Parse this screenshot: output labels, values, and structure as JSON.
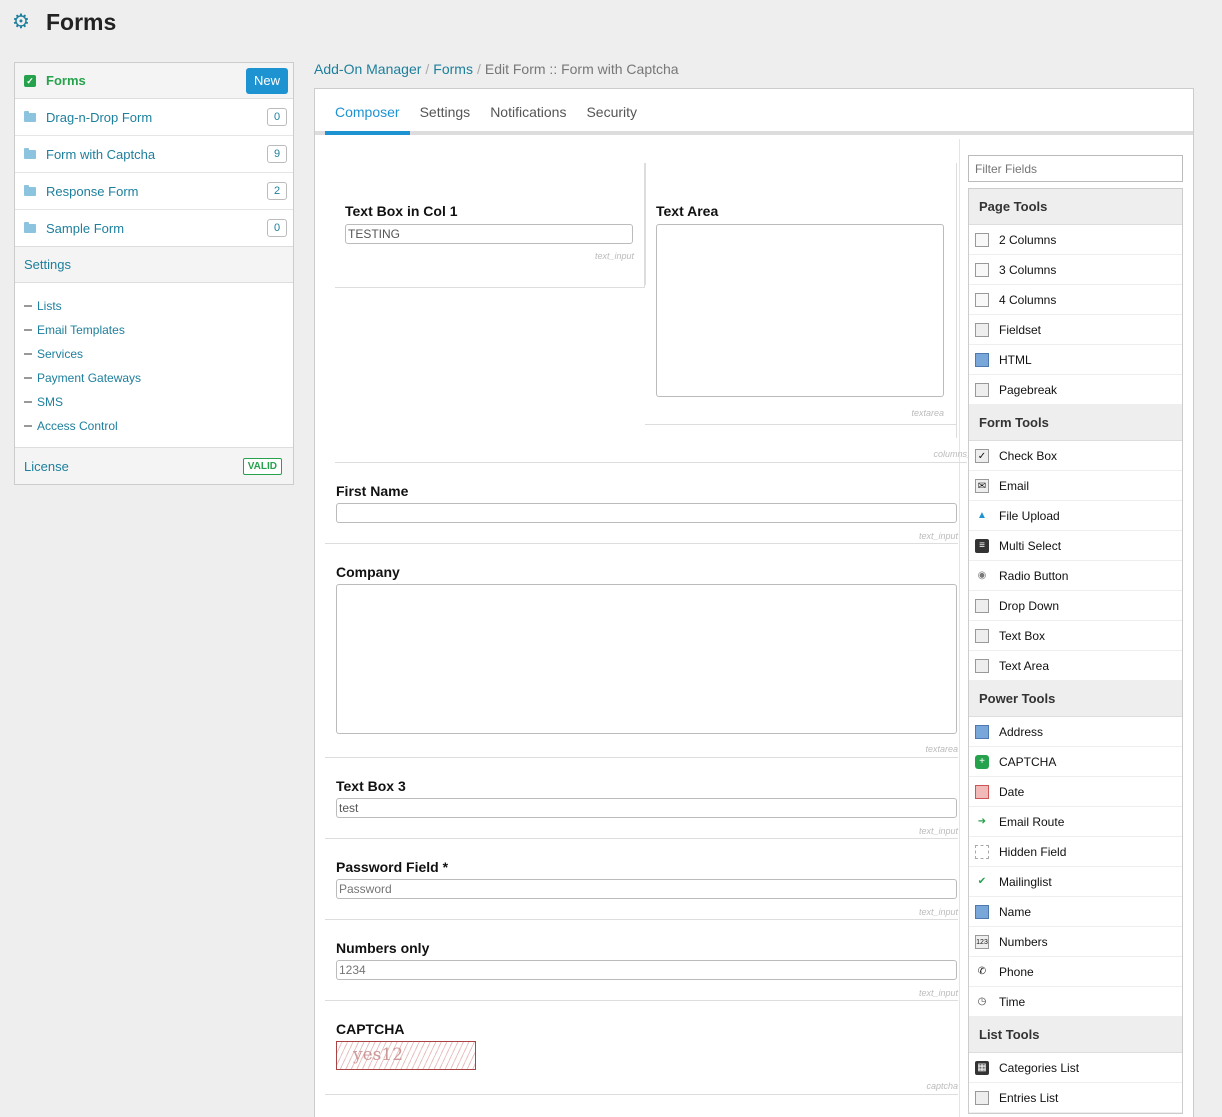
{
  "header": {
    "title": "Forms"
  },
  "sidebar": {
    "forms_label": "Forms",
    "new_label": "New",
    "forms": [
      {
        "name": "Drag-n-Drop Form",
        "count": "0"
      },
      {
        "name": "Form with Captcha",
        "count": "9"
      },
      {
        "name": "Response Form",
        "count": "2"
      },
      {
        "name": "Sample Form",
        "count": "0"
      }
    ],
    "settings_label": "Settings",
    "settings_items": [
      "Lists",
      "Email Templates",
      "Services",
      "Payment Gateways",
      "SMS",
      "Access Control"
    ],
    "license_label": "License",
    "license_status": "VALID"
  },
  "breadcrumb": {
    "items": [
      "Add-On Manager",
      "Forms"
    ],
    "current": "Edit Form :: Form with Captcha",
    "sep": "/"
  },
  "tabs": [
    "Composer",
    "Settings",
    "Notifications",
    "Security"
  ],
  "canvas": {
    "col1": {
      "label": "Text Box in Col 1",
      "value": "TESTING",
      "type": "text_input"
    },
    "col2": {
      "label": "Text Area",
      "type": "textarea"
    },
    "columns_type": "columns_2",
    "fields": [
      {
        "label": "First Name",
        "value": "",
        "type": "text_input"
      },
      {
        "label": "Company",
        "type": "textarea"
      },
      {
        "label": "Text Box 3",
        "value": "test",
        "type": "text_input"
      },
      {
        "label": "Password Field *",
        "placeholder": "Password",
        "type": "text_input"
      },
      {
        "label": "Numbers only",
        "placeholder": "1234",
        "type": "text_input"
      },
      {
        "label": "CAPTCHA",
        "captcha_text": "yes12",
        "type": "captcha"
      }
    ]
  },
  "tools": {
    "filter_placeholder": "Filter Fields",
    "groups": [
      {
        "title": "Page Tools",
        "items": [
          {
            "label": "2 Columns",
            "icon": "two-columns-icon"
          },
          {
            "label": "3 Columns",
            "icon": "three-columns-icon"
          },
          {
            "label": "4 Columns",
            "icon": "four-columns-icon"
          },
          {
            "label": "Fieldset",
            "icon": "fieldset-icon"
          },
          {
            "label": "HTML",
            "icon": "html-icon"
          },
          {
            "label": "Pagebreak",
            "icon": "pagebreak-icon"
          }
        ]
      },
      {
        "title": "Form Tools",
        "items": [
          {
            "label": "Check Box",
            "icon": "checkbox-icon"
          },
          {
            "label": "Email",
            "icon": "email-icon"
          },
          {
            "label": "File Upload",
            "icon": "file-upload-icon"
          },
          {
            "label": "Multi Select",
            "icon": "multi-select-icon"
          },
          {
            "label": "Radio Button",
            "icon": "radio-button-icon"
          },
          {
            "label": "Drop Down",
            "icon": "dropdown-icon"
          },
          {
            "label": "Text Box",
            "icon": "text-box-icon"
          },
          {
            "label": "Text Area",
            "icon": "text-area-icon"
          }
        ]
      },
      {
        "title": "Power Tools",
        "items": [
          {
            "label": "Address",
            "icon": "address-icon"
          },
          {
            "label": "CAPTCHA",
            "icon": "captcha-icon"
          },
          {
            "label": "Date",
            "icon": "date-icon"
          },
          {
            "label": "Email Route",
            "icon": "email-route-icon"
          },
          {
            "label": "Hidden Field",
            "icon": "hidden-field-icon"
          },
          {
            "label": "Mailinglist",
            "icon": "mailinglist-icon"
          },
          {
            "label": "Name",
            "icon": "name-icon"
          },
          {
            "label": "Numbers",
            "icon": "numbers-icon"
          },
          {
            "label": "Phone",
            "icon": "phone-icon"
          },
          {
            "label": "Time",
            "icon": "time-icon"
          }
        ]
      },
      {
        "title": "List Tools",
        "items": [
          {
            "label": "Categories List",
            "icon": "categories-list-icon"
          },
          {
            "label": "Entries List",
            "icon": "entries-list-icon"
          }
        ]
      }
    ]
  },
  "colors": {
    "accent": "#1d93d2",
    "link": "#1d7f9c",
    "success": "#27a24c"
  }
}
